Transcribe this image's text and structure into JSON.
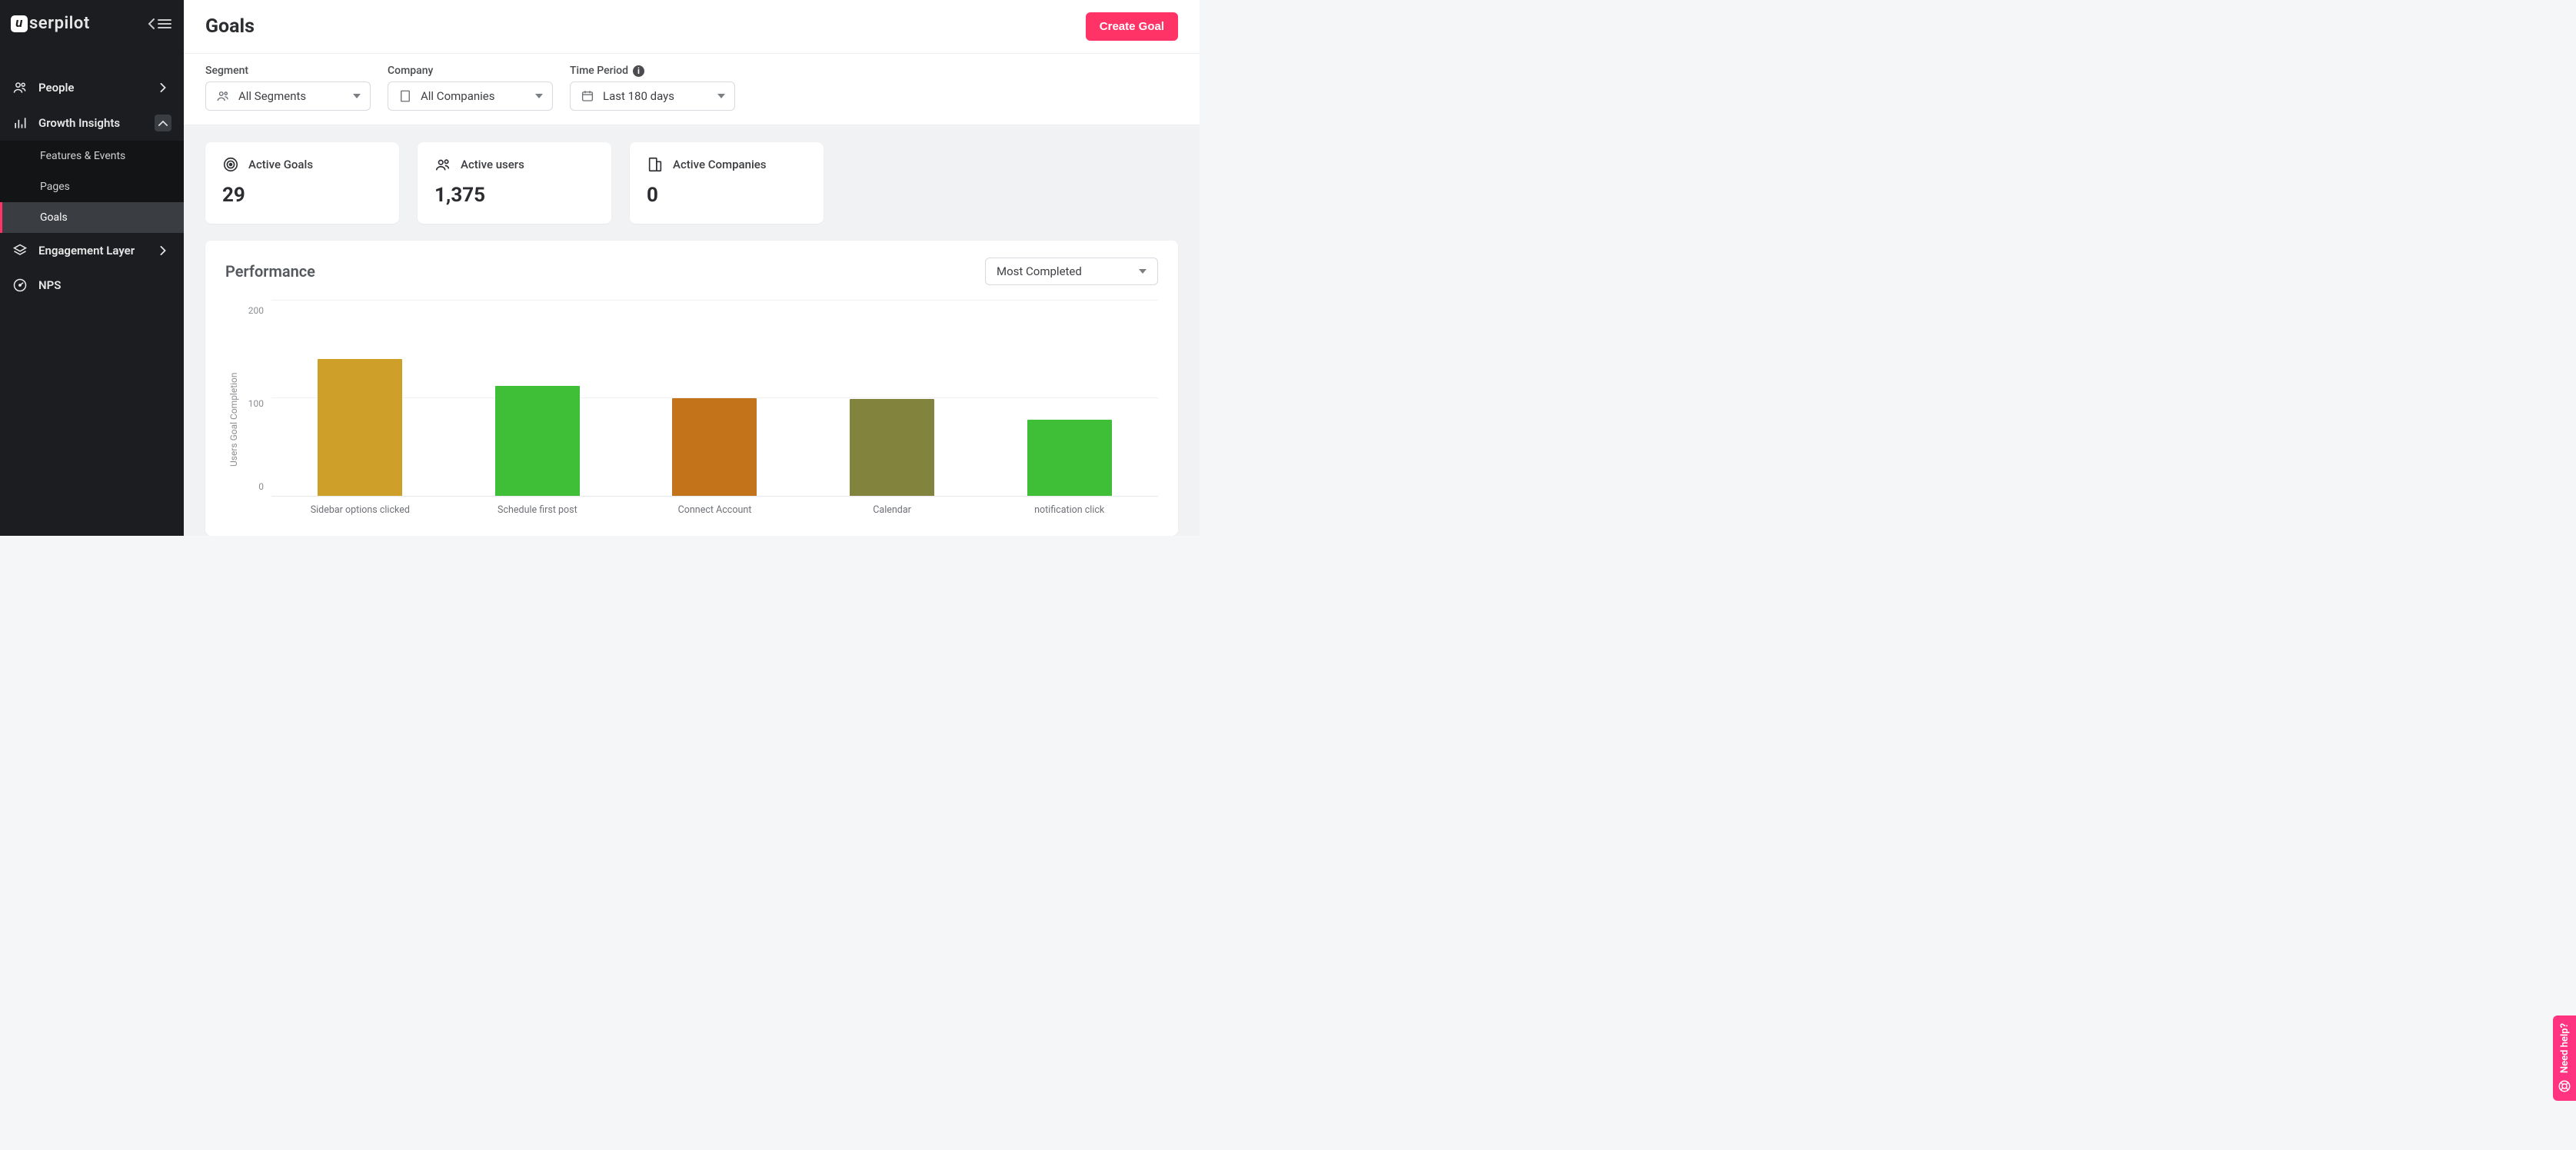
{
  "brand": "serpilot",
  "sidebar": {
    "items": [
      {
        "label": "People",
        "expand": "right"
      },
      {
        "label": "Growth Insights",
        "expand": "up",
        "children": [
          {
            "label": "Features & Events"
          },
          {
            "label": "Pages"
          },
          {
            "label": "Goals",
            "active": true
          }
        ]
      },
      {
        "label": "Engagement Layer",
        "expand": "right"
      },
      {
        "label": "NPS"
      }
    ]
  },
  "header": {
    "title": "Goals",
    "create_label": "Create Goal"
  },
  "filters": {
    "segment": {
      "label": "Segment",
      "value": "All Segments"
    },
    "company": {
      "label": "Company",
      "value": "All Companies"
    },
    "time": {
      "label": "Time Period",
      "value": "Last 180 days"
    }
  },
  "stats": {
    "active_goals": {
      "label": "Active Goals",
      "value": "29"
    },
    "active_users": {
      "label": "Active users",
      "value": "1,375"
    },
    "active_companies": {
      "label": "Active Companies",
      "value": "0"
    }
  },
  "performance": {
    "title": "Performance",
    "sort_value": "Most Completed"
  },
  "help_label": "Need help?",
  "colors": {
    "accent": "#ff3366"
  },
  "chart_data": {
    "type": "bar",
    "ylabel": "Users Goal Completion",
    "ylim": [
      0,
      200
    ],
    "yticks": [
      200,
      100,
      0
    ],
    "categories": [
      "Sidebar options clicked",
      "Schedule first post",
      "Connect Account",
      "Calendar",
      "notification click"
    ],
    "values": [
      140,
      113,
      100,
      99,
      78
    ],
    "bar_colors": [
      "#cfa029",
      "#3fbf37",
      "#c3741a",
      "#82833d",
      "#3fbf37"
    ]
  }
}
